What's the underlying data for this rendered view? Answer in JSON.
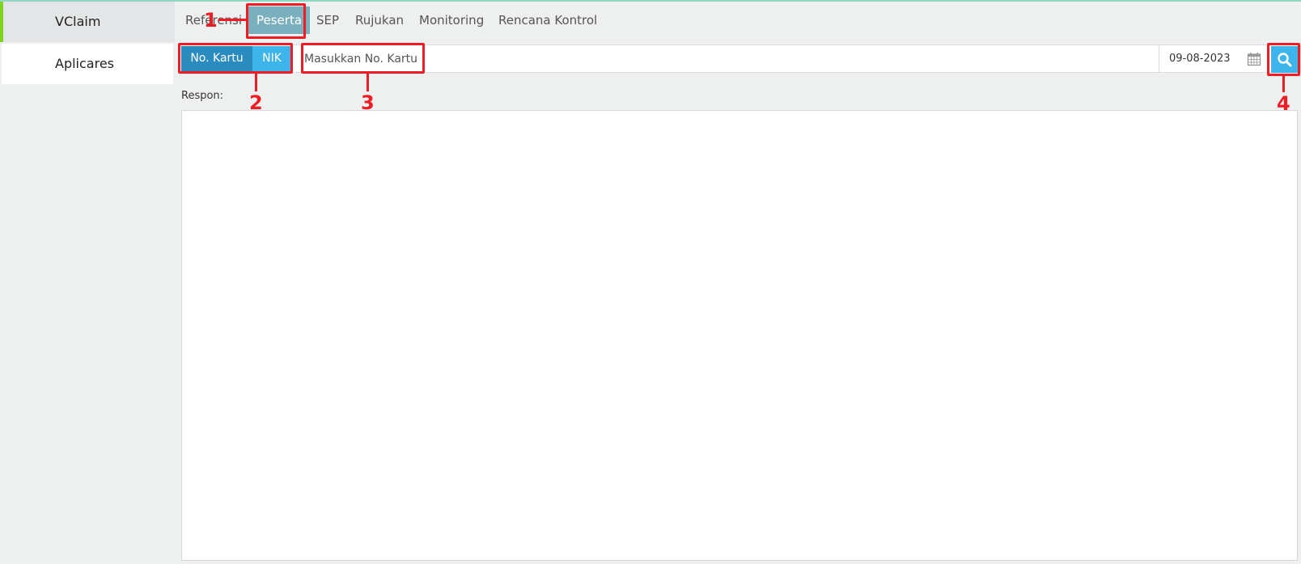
{
  "sidebar": {
    "items": [
      {
        "label": "VClaim",
        "active": true
      },
      {
        "label": "Aplicares",
        "active": false
      }
    ]
  },
  "tabs": [
    {
      "label": "Referensi",
      "active": false
    },
    {
      "label": "Peserta",
      "active": true
    },
    {
      "label": "SEP",
      "active": false
    },
    {
      "label": "Rujukan",
      "active": false
    },
    {
      "label": "Monitoring",
      "active": false
    },
    {
      "label": "Rencana Kontrol",
      "active": false
    }
  ],
  "search": {
    "mode_buttons": [
      "No. Kartu",
      "NIK"
    ],
    "placeholder": "Masukkan No. Kartu",
    "date": "09-08-2023"
  },
  "respon": {
    "label": "Respon:",
    "content": ""
  },
  "annotations": [
    "1",
    "2",
    "3",
    "4"
  ],
  "colors": {
    "accent_green": "#7ed321",
    "tab_active": "#7ab0bd",
    "btn_primary": "#2a8bbf",
    "btn_secondary": "#3db5ea",
    "annotation_red": "#ee1c25"
  }
}
